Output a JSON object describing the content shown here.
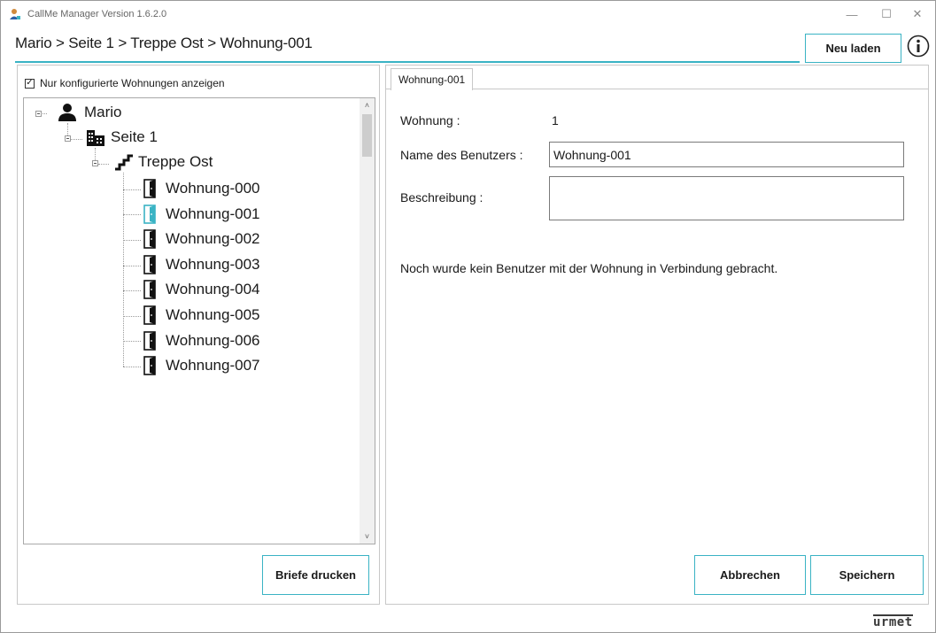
{
  "window": {
    "title": "CallMe Manager Version 1.6.2.0",
    "controls": {
      "minimize": "—",
      "maximize": "☐",
      "close": "✕"
    }
  },
  "header": {
    "breadcrumb": "Mario > Seite 1 > Treppe Ost > Wohnung-001",
    "reload_label": "Neu laden",
    "info_icon": "info-icon"
  },
  "left": {
    "checkbox_label": "Nur konfigurierte Wohnungen anzeigen",
    "checkbox_checked": true,
    "tree": {
      "root": "Mario",
      "page": "Seite 1",
      "stair": "Treppe Ost",
      "apartments": [
        "Wohnung-000",
        "Wohnung-001",
        "Wohnung-002",
        "Wohnung-003",
        "Wohnung-004",
        "Wohnung-005",
        "Wohnung-006",
        "Wohnung-007"
      ],
      "selected": "Wohnung-001"
    },
    "print_label": "Briefe drucken"
  },
  "right": {
    "tab_label": "Wohnung-001",
    "apartment_label": "Wohnung :",
    "apartment_value": "1",
    "username_label": "Name des Benutzers :",
    "username_value": "Wohnung-001",
    "description_label": "Beschreibung :",
    "description_value": "",
    "message": "Noch wurde kein Benutzer mit der Wohnung in Verbindung gebracht.",
    "cancel_label": "Abbrechen",
    "save_label": "Speichern"
  },
  "brand": "urmet",
  "colors": {
    "accent": "#3ab3c4",
    "selected_door": "#3ab3c4"
  }
}
